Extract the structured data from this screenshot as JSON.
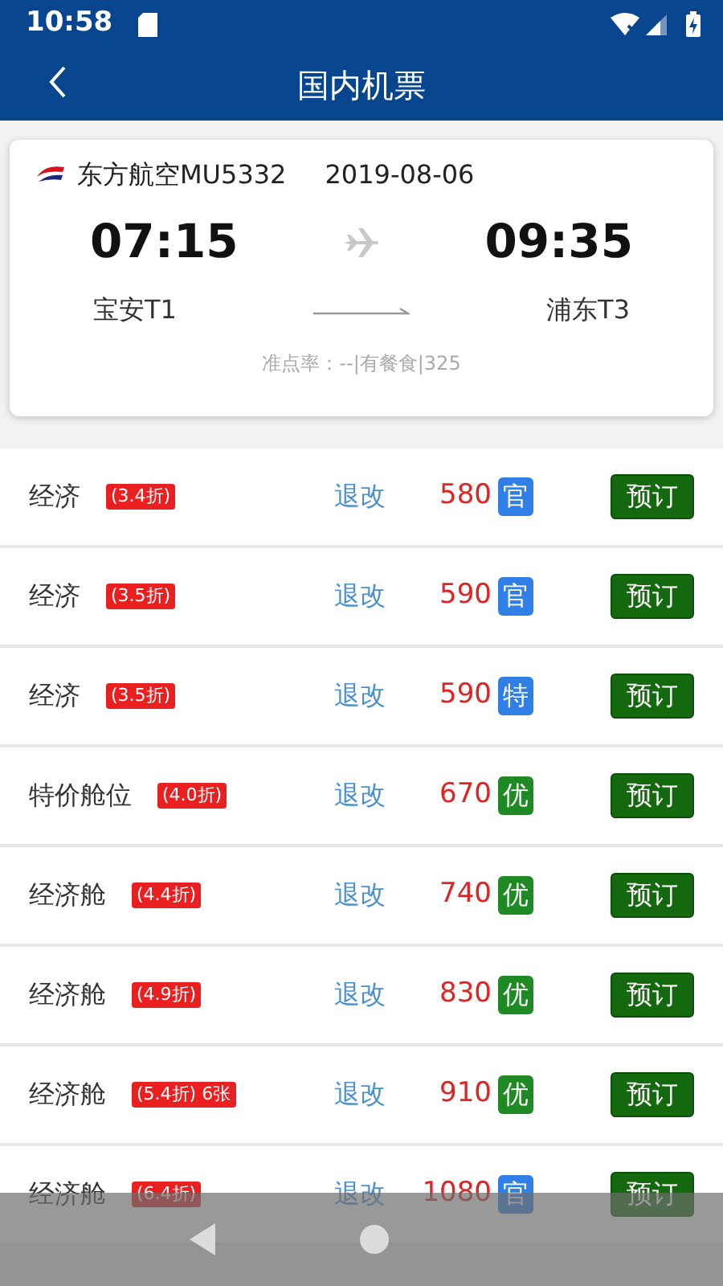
{
  "status_bar": {
    "time": "10:58"
  },
  "header": {
    "title": "国内机票"
  },
  "flight": {
    "airline": "东方航空MU5332",
    "date": "2019-08-06",
    "depart_time": "07:15",
    "arrive_time": "09:35",
    "depart_airport": "宝安T1",
    "arrive_airport": "浦东T3",
    "info": "准点率：--|有餐食|325"
  },
  "fares": [
    {
      "cabin": "经济",
      "discount": "(3.4折)",
      "refund": "退改",
      "price": "580",
      "tag": "官",
      "color": "#2f7fe6",
      "button": "预订"
    },
    {
      "cabin": "经济",
      "discount": "(3.5折)",
      "refund": "退改",
      "price": "590",
      "tag": "官",
      "color": "#2f7fe6",
      "button": "预订"
    },
    {
      "cabin": "经济",
      "discount": "(3.5折)",
      "refund": "退改",
      "price": "590",
      "tag": "特",
      "color": "#2f7fe6",
      "button": "预订"
    },
    {
      "cabin": "特价舱位",
      "discount": "(4.0折)",
      "refund": "退改",
      "price": "670",
      "tag": "优",
      "color": "#1f8a24",
      "button": "预订"
    },
    {
      "cabin": "经济舱",
      "discount": "(4.4折)",
      "refund": "退改",
      "price": "740",
      "tag": "优",
      "color": "#1f8a24",
      "button": "预订"
    },
    {
      "cabin": "经济舱",
      "discount": "(4.9折)",
      "refund": "退改",
      "price": "830",
      "tag": "优",
      "color": "#1f8a24",
      "button": "预订"
    },
    {
      "cabin": "经济舱",
      "discount": "(5.4折) 6张",
      "refund": "退改",
      "price": "910",
      "tag": "优",
      "color": "#1f8a24",
      "button": "预订"
    },
    {
      "cabin": "经济舱",
      "discount": "(6.4折)",
      "refund": "退改",
      "price": "1080",
      "tag": "官",
      "color": "#2f7fe6",
      "button": "预订"
    }
  ]
}
